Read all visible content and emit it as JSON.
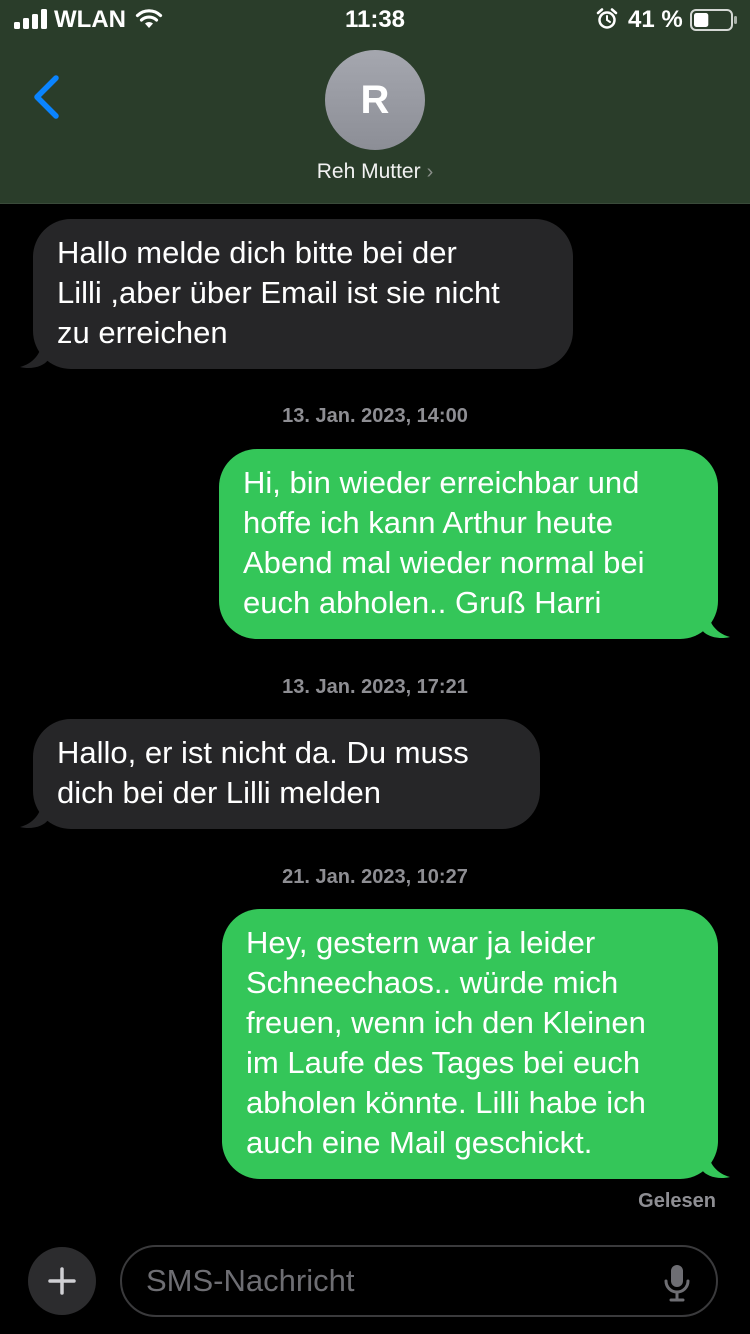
{
  "status_bar": {
    "carrier": "WLAN",
    "time": "11:38",
    "battery_percent": "41 %",
    "battery_level": 0.41
  },
  "header": {
    "avatar_initial": "R",
    "contact_name": "Reh Mutter"
  },
  "messages": [
    {
      "direction": "incoming",
      "text": "Hallo  melde dich bitte bei der\nLilli ,aber über Email ist sie nicht\nzu erreichen"
    },
    {
      "timestamp": "13. Jan. 2023, 14:00"
    },
    {
      "direction": "outgoing",
      "text": "Hi, bin wieder erreichbar und\nhoffe ich kann Arthur heute\nAbend mal wieder normal bei\neuch abholen.. Gruß Harri"
    },
    {
      "timestamp": "13. Jan. 2023, 17:21"
    },
    {
      "direction": "incoming",
      "text": "Hallo, er ist nicht da. Du muss\ndich bei der Lilli melden"
    },
    {
      "timestamp": "21. Jan. 2023, 10:27"
    },
    {
      "direction": "outgoing",
      "text": "Hey, gestern war ja leider\nSchneechaos.. würde mich\nfreuen, wenn ich den Kleinen\nim Laufe des Tages bei euch\nabholen könnte. Lilli habe ich\nauch eine Mail geschickt."
    }
  ],
  "read_receipt": "Gelesen",
  "composer": {
    "placeholder": "SMS-Nachricht"
  },
  "colors": {
    "header_bg": "#2a3d2a",
    "incoming_bubble": "#262628",
    "outgoing_bubble": "#34c659",
    "accent": "#0a84ff"
  }
}
